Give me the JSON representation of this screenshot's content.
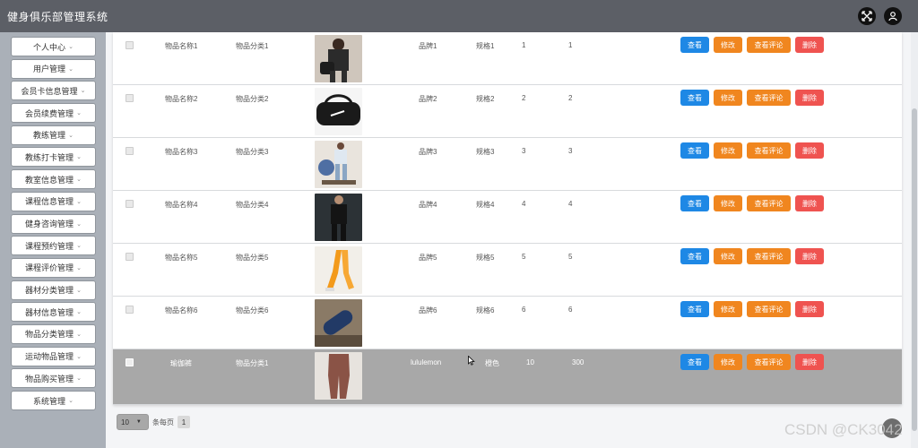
{
  "app": {
    "title": "健身俱乐部管理系统"
  },
  "sidebar": {
    "items": [
      {
        "label": "个人中心"
      },
      {
        "label": "用户管理"
      },
      {
        "label": "会员卡信息管理"
      },
      {
        "label": "会员续费管理"
      },
      {
        "label": "教练管理"
      },
      {
        "label": "教练打卡管理"
      },
      {
        "label": "教室信息管理"
      },
      {
        "label": "课程信息管理"
      },
      {
        "label": "健身咨询管理"
      },
      {
        "label": "课程预约管理"
      },
      {
        "label": "课程评价管理"
      },
      {
        "label": "器材分类管理"
      },
      {
        "label": "器材信息管理"
      },
      {
        "label": "物品分类管理"
      },
      {
        "label": "运动物品管理"
      },
      {
        "label": "物品购买管理"
      },
      {
        "label": "系统管理"
      }
    ]
  },
  "actions": {
    "view": "查看",
    "edit": "修改",
    "comments": "查看评论",
    "delete": "删除"
  },
  "rows": [
    {
      "name": "物品名称1",
      "category": "物品分类1",
      "brand": "品牌1",
      "spec": "规格1",
      "c1": "1",
      "c2": "1"
    },
    {
      "name": "物品名称2",
      "category": "物品分类2",
      "brand": "品牌2",
      "spec": "规格2",
      "c1": "2",
      "c2": "2"
    },
    {
      "name": "物品名称3",
      "category": "物品分类3",
      "brand": "品牌3",
      "spec": "规格3",
      "c1": "3",
      "c2": "3"
    },
    {
      "name": "物品名称4",
      "category": "物品分类4",
      "brand": "品牌4",
      "spec": "规格4",
      "c1": "4",
      "c2": "4"
    },
    {
      "name": "物品名称5",
      "category": "物品分类5",
      "brand": "品牌5",
      "spec": "规格5",
      "c1": "5",
      "c2": "5"
    },
    {
      "name": "物品名称6",
      "category": "物品分类6",
      "brand": "品牌6",
      "spec": "规格6",
      "c1": "6",
      "c2": "6"
    },
    {
      "name": "瑜伽裤",
      "category": "物品分类1",
      "brand": "lululemon",
      "spec": "橙色",
      "c1": "10",
      "c2": "300"
    }
  ],
  "pagination": {
    "page_size": "10",
    "per_page_label": "条每页",
    "current_page": "1"
  },
  "watermark": "CSDN @CK3042",
  "colors": {
    "topbar": "#5c5f66",
    "sidebar": "#aab0b8",
    "view": "#1e88e5",
    "edit": "#f0861f",
    "delete": "#ef5350",
    "selected_row": "#a8a8a8"
  }
}
